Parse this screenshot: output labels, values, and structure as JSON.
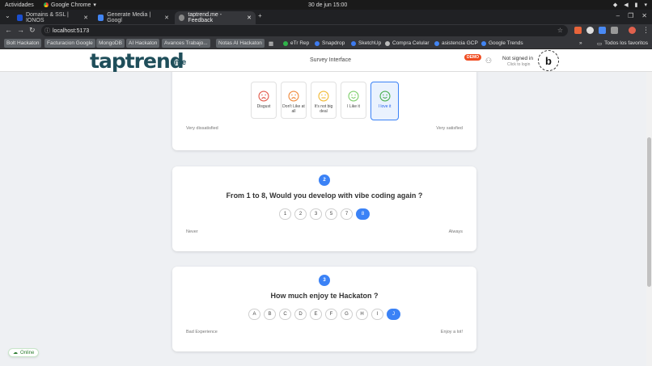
{
  "os": {
    "activities": "Actividades",
    "app_name": "Google Chrome",
    "clock": "30 de jun  15:00"
  },
  "browser": {
    "tabs": [
      {
        "title": "Domains & SSL | IONOS"
      },
      {
        "title": "Generate Media | Googl"
      },
      {
        "title": "taptrend.me - Feedback"
      }
    ],
    "url": "localhost:5173",
    "bookmarks": [
      "Bolt Hackaton",
      "Facturacion Google",
      "MongoDB",
      "AI Hackaton",
      "Avances Trabajo...",
      "Notas AI Hackaton",
      "eTr Rep",
      "Snapdrop",
      "SketchUp",
      "Compra Celular",
      "asistencia GCP",
      "Google Trends"
    ],
    "all_favorites": "Todos los favoritos"
  },
  "header": {
    "logo": "taptrend",
    "logo_suffix": ".me",
    "title": "Survey Interface",
    "demo_badge": "DEMO",
    "signin": "Not signed in",
    "signin_sub": "Click to login",
    "bolt_badge": "b"
  },
  "q1": {
    "options": [
      {
        "label": "Disgust",
        "color": "#e25b4b",
        "mood": "sad"
      },
      {
        "label": "Don't Like at all",
        "color": "#f08a3c",
        "mood": "sad"
      },
      {
        "label": "It's not big deal",
        "color": "#f2b933",
        "mood": "neutral"
      },
      {
        "label": "I Like it",
        "color": "#7fcf6b",
        "mood": "happy"
      },
      {
        "label": "I love it",
        "color": "#4caf50",
        "mood": "happy"
      }
    ],
    "selected": 4,
    "low_label": "Very dissatisfied",
    "high_label": "Very satisfied"
  },
  "q2": {
    "number": "2",
    "title": "From 1 to 8, Would you develop with vibe coding again ?",
    "options": [
      "1",
      "2",
      "3",
      "5",
      "7",
      "8"
    ],
    "selected": 5,
    "low_label": "Never",
    "high_label": "Always"
  },
  "q3": {
    "number": "3",
    "title": "How much enjoy te Hackaton ?",
    "options": [
      "A",
      "B",
      "C",
      "D",
      "E",
      "F",
      "G",
      "H",
      "I",
      "J"
    ],
    "selected": 9,
    "low_label": "Bad Experience",
    "high_label": "Enjoy a lot!"
  },
  "status": {
    "online": "Online"
  }
}
